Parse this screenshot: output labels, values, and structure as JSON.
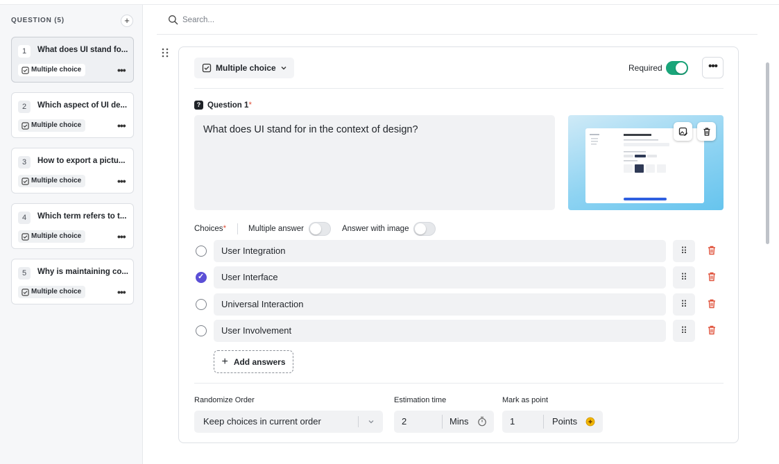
{
  "sidebar": {
    "header": "QUESTION (5)",
    "add_symbol": "+",
    "questions": [
      {
        "num": "1",
        "title": "What does UI stand fo...",
        "type": "Multiple choice",
        "more": "•••"
      },
      {
        "num": "2",
        "title": "Which aspect of UI de...",
        "type": "Multiple choice",
        "more": "•••"
      },
      {
        "num": "3",
        "title": "How to export a pictu...",
        "type": "Multiple choice",
        "more": "•••"
      },
      {
        "num": "4",
        "title": "Which term refers to t...",
        "type": "Multiple choice",
        "more": "•••"
      },
      {
        "num": "5",
        "title": "Why is maintaining co...",
        "type": "Multiple choice",
        "more": "•••"
      }
    ]
  },
  "search": {
    "placeholder": "Search..."
  },
  "editor": {
    "type_select": "Multiple choice",
    "required_label": "Required",
    "required_on": true,
    "more": "•••",
    "question_badge": "?",
    "question_label": "Question 1",
    "required_star": "*",
    "question_text": "What does UI stand for in the context of design?",
    "choices_label": "Choices",
    "multiple_answer_label": "Multiple answer",
    "answer_with_image_label": "Answer with image",
    "choices": [
      {
        "text": "User Integration",
        "checked": false
      },
      {
        "text": "User Interface",
        "checked": true
      },
      {
        "text": "Universal Interaction",
        "checked": false
      },
      {
        "text": "User Involvement",
        "checked": false
      }
    ],
    "drag_symbol": "⠿",
    "add_answers_label": "Add answers",
    "add_symbol": "+",
    "randomize_label": "Randomize Order",
    "randomize_value": "Keep choices in current order",
    "estimation_label": "Estimation time",
    "estimation_value": "2",
    "estimation_unit": "Mins",
    "mark_label": "Mark as point",
    "mark_value": "1",
    "mark_unit": "Points"
  },
  "colors": {
    "toggle_on": "#1aa57a",
    "radio_checked": "#5b4fd6",
    "delete_red": "#e0533d",
    "points_gold": "#f2b705"
  },
  "icons": [
    "search-icon",
    "drag-handle-icon",
    "checklist-icon",
    "chevron-down-icon",
    "question-icon",
    "image-edit-icon",
    "trash-icon",
    "plus-icon",
    "timer-icon",
    "coin-icon"
  ]
}
